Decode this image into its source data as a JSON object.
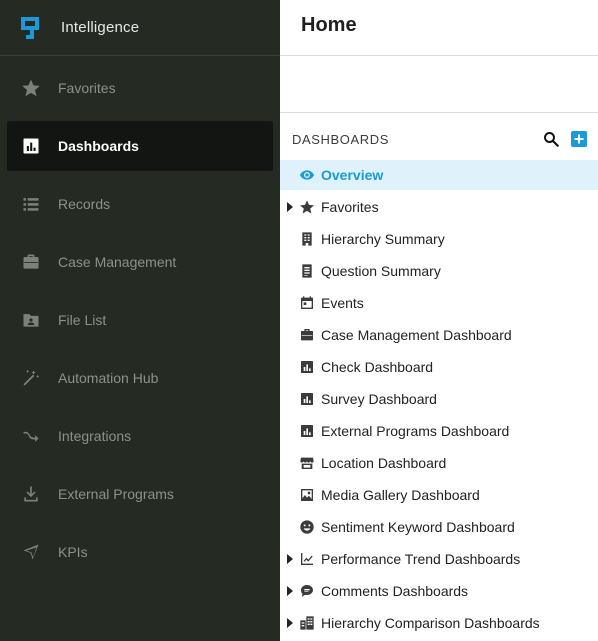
{
  "app": {
    "title": "Intelligence",
    "logo_icon": "intelligence-logo-icon"
  },
  "sidebar": {
    "items": [
      {
        "label": "Favorites",
        "icon": "star-icon"
      },
      {
        "label": "Dashboards",
        "icon": "bar-chart-icon",
        "active": true
      },
      {
        "label": "Records",
        "icon": "list-icon"
      },
      {
        "label": "Case Management",
        "icon": "briefcase-icon"
      },
      {
        "label": "File List",
        "icon": "folder-user-icon"
      },
      {
        "label": "Automation Hub",
        "icon": "magic-wand-icon"
      },
      {
        "label": "Integrations",
        "icon": "integration-arrow-icon"
      },
      {
        "label": "External Programs",
        "icon": "download-icon"
      },
      {
        "label": "KPIs",
        "icon": "send-icon"
      }
    ]
  },
  "main": {
    "page_title": "Home",
    "section_title": "DASHBOARDS",
    "search_icon": "search-icon",
    "add_icon": "add-icon",
    "tree": [
      {
        "label": "Overview",
        "icon": "eye-icon",
        "active": true,
        "expandable": false
      },
      {
        "label": "Favorites",
        "icon": "star-icon",
        "expandable": true
      },
      {
        "label": "Hierarchy Summary",
        "icon": "building-icon",
        "expandable": false
      },
      {
        "label": "Question Summary",
        "icon": "document-icon",
        "expandable": false
      },
      {
        "label": "Events",
        "icon": "calendar-icon",
        "expandable": false
      },
      {
        "label": "Case Management Dashboard",
        "icon": "briefcase-icon",
        "expandable": false
      },
      {
        "label": "Check Dashboard",
        "icon": "bar-chart-icon",
        "expandable": false
      },
      {
        "label": "Survey Dashboard",
        "icon": "bar-chart-icon",
        "expandable": false
      },
      {
        "label": "External Programs Dashboard",
        "icon": "bar-chart-icon",
        "expandable": false
      },
      {
        "label": "Location Dashboard",
        "icon": "store-icon",
        "expandable": false
      },
      {
        "label": "Media Gallery Dashboard",
        "icon": "image-icon",
        "expandable": false
      },
      {
        "label": "Sentiment Keyword Dashboard",
        "icon": "smile-icon",
        "expandable": false
      },
      {
        "label": "Performance Trend Dashboards",
        "icon": "trend-chart-icon",
        "expandable": true
      },
      {
        "label": "Comments Dashboards",
        "icon": "comment-icon",
        "expandable": true
      },
      {
        "label": "Hierarchy Comparison Dashboards",
        "icon": "buildings-icon",
        "expandable": true
      }
    ]
  },
  "colors": {
    "sidebar_bg": "#252a23",
    "sidebar_active_bg": "#121512",
    "accent": "#1a9ad8",
    "active_row_bg": "#dff1fa"
  }
}
